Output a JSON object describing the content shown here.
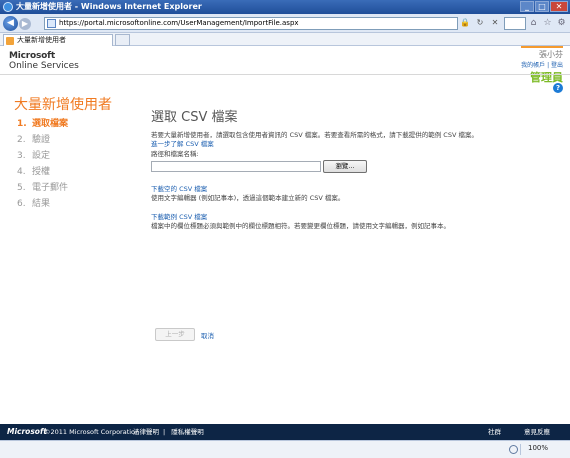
{
  "browser": {
    "title": "大量新增使用者 - Windows Internet Explorer",
    "url": "https://portal.microsoftonline.com/UserManagement/ImportFile.aspx",
    "tab_label": "大量新增使用者",
    "zoom": "100%"
  },
  "header": {
    "logo_line1": "Microsoft",
    "logo_line2": "Online Services",
    "username": "張小芬",
    "user_links": "我的帳戶 | 登出",
    "role": "管理員"
  },
  "wizard": {
    "title": "大量新增使用者",
    "steps": [
      {
        "num": "1.",
        "label": "選取檔案"
      },
      {
        "num": "2.",
        "label": "驗證"
      },
      {
        "num": "3.",
        "label": "設定"
      },
      {
        "num": "4.",
        "label": "授權"
      },
      {
        "num": "5.",
        "label": "電子郵件"
      },
      {
        "num": "6.",
        "label": "結果"
      }
    ]
  },
  "content": {
    "title": "選取 CSV 檔案",
    "description": "若要大量新增使用者，請選取包含使用者資訊的 CSV 檔案。若要查看所需的格式，請下載提供的範例 CSV 檔案。",
    "learn_more": "進一步了解 CSV 檔案",
    "path_label": "路徑和檔案名稱:",
    "browse": "瀏覽...",
    "blank_link": "下載空的 CSV 檔案",
    "blank_desc": "使用文字編輯器 (例如記事本)，透過這個範本建立新的 CSV 檔案。",
    "sample_link": "下載範例 CSV 檔案",
    "sample_desc": "檔案中的欄位標題必須與範例中的欄位標題相符。若要變更欄位標題，請使用文字編輯器，例如記事本。"
  },
  "actions": {
    "prev": "上一步",
    "cancel": "取消"
  },
  "footer": {
    "brand": "Microsoft",
    "copyright": "©2011 Microsoft Corporation",
    "legal": "法律聲明",
    "privacy": "隱私權聲明",
    "community": "社群",
    "feedback": "意見反應"
  }
}
